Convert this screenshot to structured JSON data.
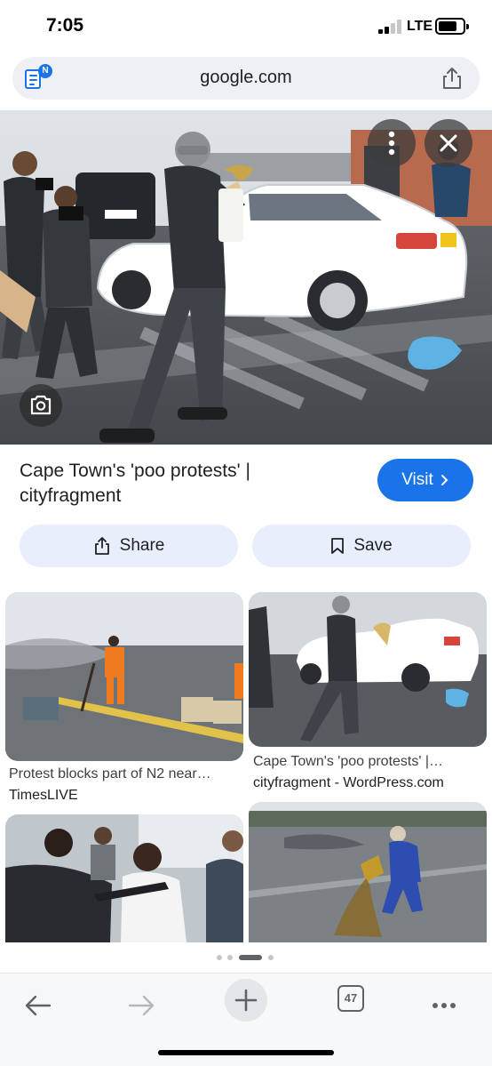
{
  "status_bar": {
    "time": "7:05",
    "network": "LTE"
  },
  "address_bar": {
    "url": "google.com",
    "badge": "N"
  },
  "result": {
    "title": "Cape Town's 'poo protests' | cityfragment",
    "visit_label": "Visit",
    "share_label": "Share",
    "save_label": "Save"
  },
  "related": [
    {
      "caption": "Protest blocks part of N2 near…",
      "source": "TimesLIVE"
    },
    {
      "caption": "Cape Town's 'poo protests' |…",
      "source": "cityfragment - WordPress.com"
    },
    {
      "caption": "",
      "source": ""
    },
    {
      "caption": "",
      "source": ""
    }
  ],
  "toolbar": {
    "tab_count": "47"
  },
  "colors": {
    "accent": "#1a73e8",
    "button_bg": "#e8eefb",
    "address_bg": "#eef0f3"
  },
  "icons": {
    "back": "arrow-left-icon",
    "forward": "arrow-right-icon",
    "new_tab": "plus-icon",
    "tabs": "tab-switcher-icon",
    "more": "ellipsis-icon"
  }
}
